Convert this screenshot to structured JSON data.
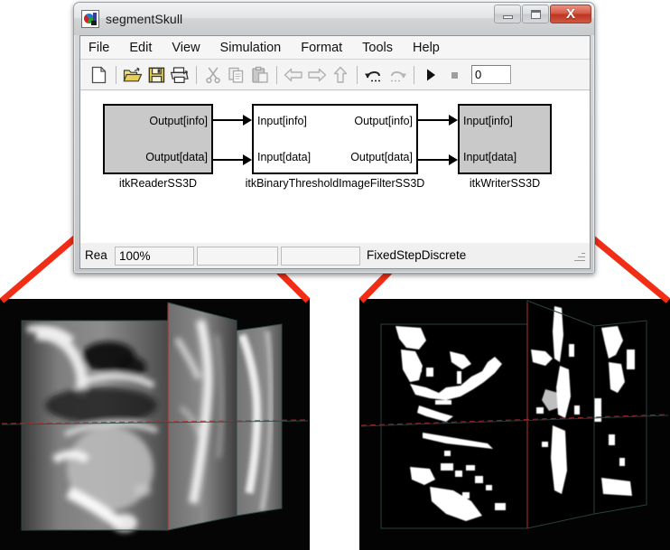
{
  "window": {
    "title": "segmentSkull",
    "icon": "simulink-model-icon",
    "controls": {
      "minimize": "minimize-button",
      "maximize": "maximize-button",
      "close_label": "X"
    }
  },
  "menu": {
    "items": [
      {
        "label": "File"
      },
      {
        "label": "Edit"
      },
      {
        "label": "View"
      },
      {
        "label": "Simulation"
      },
      {
        "label": "Format"
      },
      {
        "label": "Tools"
      },
      {
        "label": "Help"
      }
    ]
  },
  "toolbar": {
    "buttons": [
      {
        "name": "new-model-icon",
        "enabled": true
      },
      {
        "name": "open-folder-icon",
        "enabled": true
      },
      {
        "name": "save-icon",
        "enabled": true
      },
      {
        "name": "print-icon",
        "enabled": true
      },
      {
        "name": "cut-icon",
        "enabled": false
      },
      {
        "name": "copy-icon",
        "enabled": false
      },
      {
        "name": "paste-icon",
        "enabled": false
      },
      {
        "name": "back-arrow-icon",
        "enabled": false
      },
      {
        "name": "forward-arrow-icon",
        "enabled": false
      },
      {
        "name": "up-arrow-icon",
        "enabled": false
      },
      {
        "name": "undo-icon",
        "enabled": true
      },
      {
        "name": "redo-icon",
        "enabled": false
      },
      {
        "name": "start-simulation-icon",
        "enabled": true
      },
      {
        "name": "stop-simulation-icon",
        "enabled": false
      }
    ],
    "sim_time_value": "0"
  },
  "diagram": {
    "blocks": [
      {
        "id": "reader",
        "label": "itkReaderSS3D",
        "fill": "#c9c9c9",
        "inputs": [],
        "outputs": [
          "Output[info]",
          "Output[data]"
        ]
      },
      {
        "id": "filter",
        "label": "itkBinaryThresholdImageFilterSS3D",
        "fill": "#ffffff",
        "inputs": [
          "Input[info]",
          "Input[data]"
        ],
        "outputs": [
          "Output[info]",
          "Output[data]"
        ]
      },
      {
        "id": "writer",
        "label": "itkWriterSS3D",
        "fill": "#c9c9c9",
        "inputs": [
          "Input[info]",
          "Input[data]"
        ],
        "outputs": []
      }
    ]
  },
  "statusbar": {
    "ready": "Rea",
    "zoom": "100%",
    "cell3": "",
    "cell4": "",
    "solver": "FixedStepDiscrete"
  },
  "callouts": {
    "color": "#f22d15",
    "left_source": "itkReaderSS3D",
    "right_source": "itkWriterSS3D"
  },
  "panels": {
    "left": {
      "name": "input-ct-volume-view",
      "caption": "",
      "description": "grayscale CT orthogonal slice planes"
    },
    "right": {
      "name": "segmented-volume-view",
      "caption": "",
      "description": "binary thresholded segmented orthogonal slice planes"
    }
  }
}
